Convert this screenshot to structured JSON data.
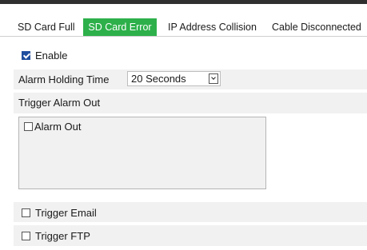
{
  "tabs": [
    "SD Card Full",
    "SD Card Error",
    "IP Address Collision",
    "Cable Disconnected"
  ],
  "active_tab": "SD Card Error",
  "enable": {
    "label": "Enable",
    "checked": true
  },
  "alarm_holding_time": {
    "label": "Alarm Holding Time",
    "value": "20 Seconds"
  },
  "trigger_alarm_out": {
    "label": "Trigger Alarm Out",
    "items": [
      {
        "label": "Alarm Out",
        "checked": false
      }
    ]
  },
  "trigger_email": {
    "label": "Trigger Email",
    "checked": false
  },
  "trigger_ftp": {
    "label": "Trigger FTP",
    "checked": false
  },
  "colors": {
    "active_tab_bg": "#2db04a",
    "checkbox_checked": "#1f4e9e",
    "band_bg": "#f1f1f1"
  }
}
